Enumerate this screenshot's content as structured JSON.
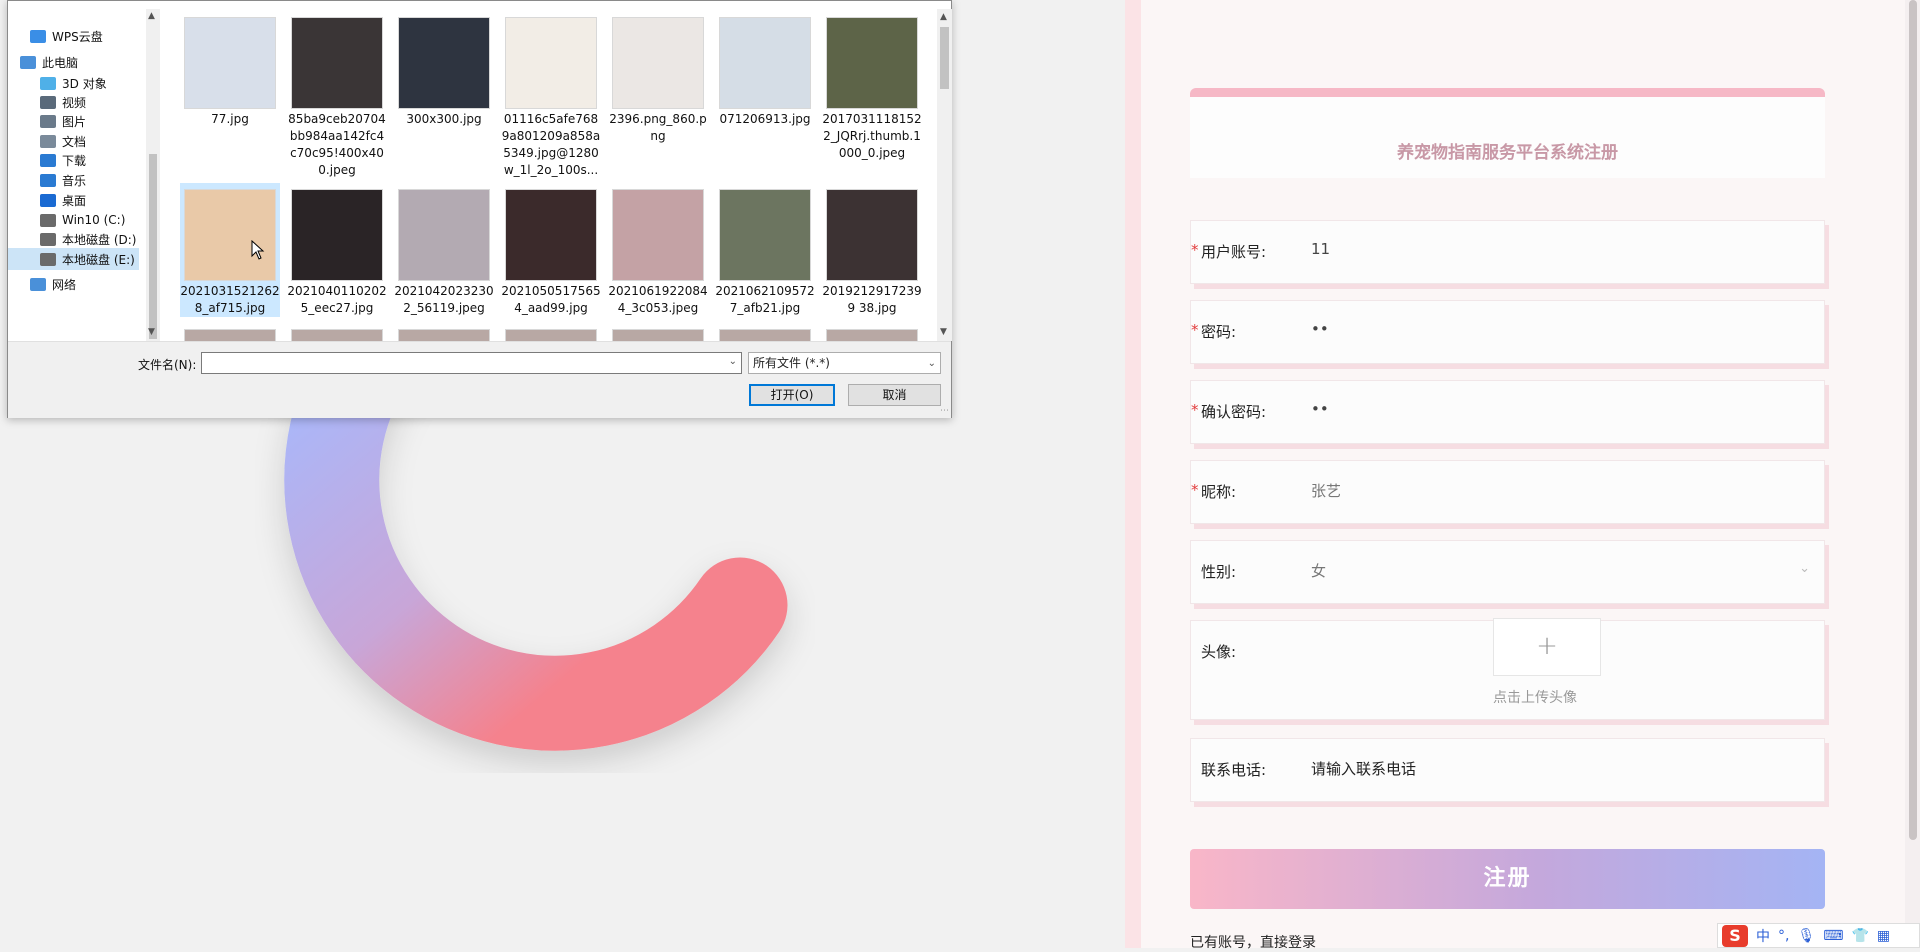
{
  "colors": {
    "accent_pink": "#f6b8c6",
    "title_pink": "#c898a6",
    "required_red": "#e23c3c",
    "button_gradient_start": "#f9b6c8",
    "button_gradient_end": "#a4b4f4",
    "arc_blue": "#a8b8fb",
    "arc_pink": "#f5828d",
    "selection_blue": "#cce8ff"
  },
  "file_dialog": {
    "nav": [
      {
        "label": "WPS云盘",
        "icon": "cloud-icon",
        "indent": 1
      },
      {
        "label": "此电脑",
        "icon": "computer-icon",
        "indent": 0
      },
      {
        "label": "3D 对象",
        "icon": "cube-icon",
        "indent": 2
      },
      {
        "label": "视频",
        "icon": "video-icon",
        "indent": 2
      },
      {
        "label": "图片",
        "icon": "picture-icon",
        "indent": 2
      },
      {
        "label": "文档",
        "icon": "document-icon",
        "indent": 2
      },
      {
        "label": "下载",
        "icon": "download-icon",
        "indent": 2
      },
      {
        "label": "音乐",
        "icon": "music-icon",
        "indent": 2
      },
      {
        "label": "桌面",
        "icon": "desktop-icon",
        "indent": 2
      },
      {
        "label": "Win10 (C:)",
        "icon": "drive-icon",
        "indent": 2
      },
      {
        "label": "本地磁盘 (D:)",
        "icon": "drive-icon",
        "indent": 2
      },
      {
        "label": "本地磁盘 (E:)",
        "icon": "drive-icon",
        "indent": 2,
        "selected": true
      },
      {
        "label": "网络",
        "icon": "network-icon",
        "indent": 1
      }
    ],
    "files": [
      {
        "name": "77.jpg",
        "color": "#d8dfea"
      },
      {
        "name": "85ba9ceb20704bb984aa142fc4c70c95!400x400.jpeg",
        "color": "#3a3536"
      },
      {
        "name": "300x300.jpg",
        "color": "#2e3440"
      },
      {
        "name": "01116c5afe7689a801209a858a5349.jpg@1280w_1l_2o_100s...",
        "color": "#f2ede6"
      },
      {
        "name": "2396.png_860.png",
        "color": "#ebe7e4"
      },
      {
        "name": "071206913.jpg",
        "color": "#d5dde6"
      },
      {
        "name": "20170311181522_JQRrj.thumb.1000_0.jpeg",
        "color": "#5d6448"
      },
      {
        "name": "20210315212628_af715.jpg",
        "color": "#e9c9a8",
        "selected": true
      },
      {
        "name": "20210401102025_eec27.jpg",
        "color": "#2a2426"
      },
      {
        "name": "20210420232302_56119.jpeg",
        "color": "#b3aab2"
      },
      {
        "name": "20210505175654_aad99.jpg",
        "color": "#3b2a2b"
      },
      {
        "name": "20210619220844_3c053.jpeg",
        "color": "#c4a2a5"
      },
      {
        "name": "20210621095727_afb21.jpg",
        "color": "#6c7560"
      },
      {
        "name": "20192129172399 38.jpg",
        "color": "#3c3233"
      }
    ],
    "filename_label": "文件名(N):",
    "filename_value": "",
    "filetype_value": "所有文件 (*.*)",
    "open_label": "打开(O)",
    "cancel_label": "取消"
  },
  "form": {
    "title": "养宠物指南服务平台系统注册",
    "fields": [
      {
        "label": "用户账号:",
        "value": "11",
        "required": true
      },
      {
        "label": "密码:",
        "value": "••",
        "required": true
      },
      {
        "label": "确认密码:",
        "value": "••",
        "required": true
      },
      {
        "label": "昵称:",
        "value": "张艺",
        "required": true
      },
      {
        "label": "性别:",
        "value": "女",
        "required": false
      }
    ],
    "avatar_label": "头像:",
    "avatar_upload_icon": "+",
    "avatar_hint": "点击上传头像",
    "phone_label": "联系电话:",
    "phone_placeholder": "请输入联系电话",
    "register_label": "注册",
    "login_link": "已有账号，直接登录"
  },
  "ime_bar": {
    "logo": "S",
    "mode": "中"
  }
}
